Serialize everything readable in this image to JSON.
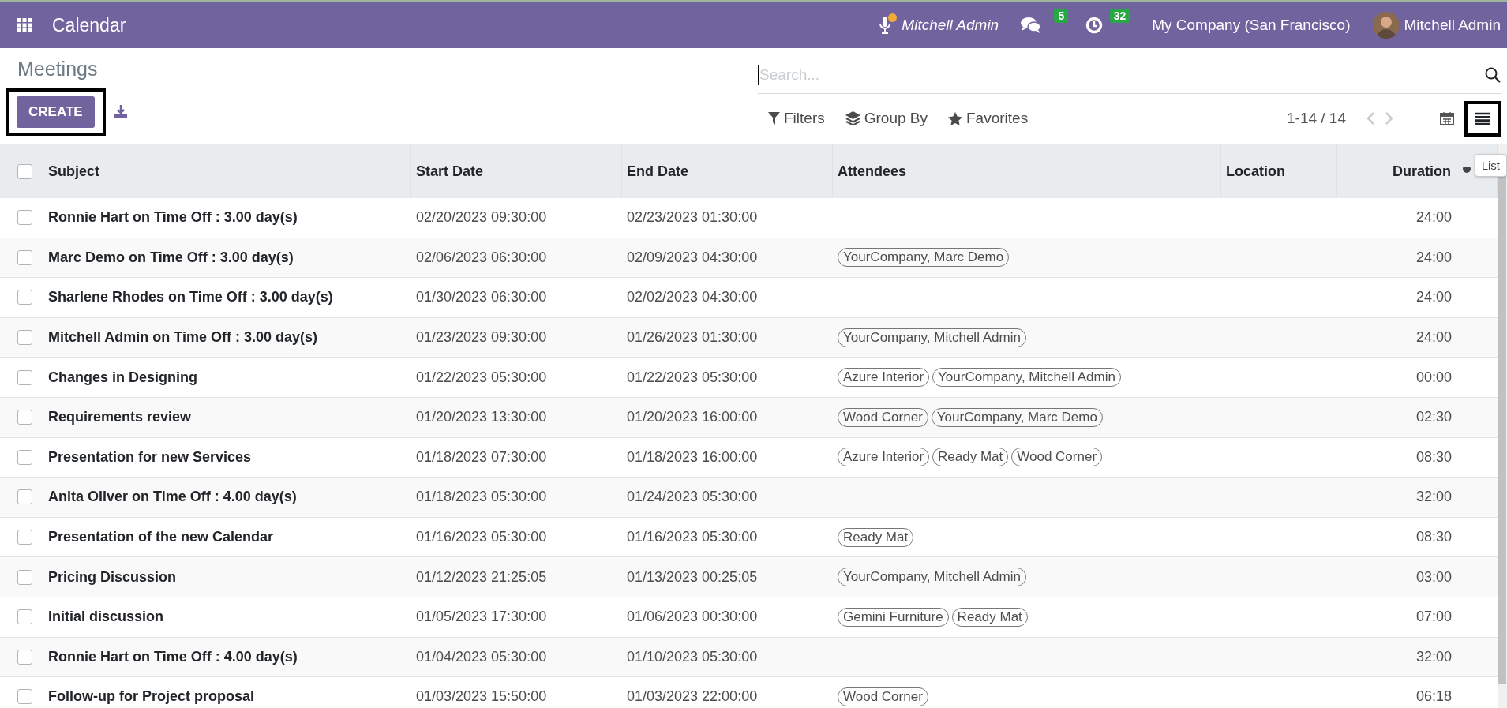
{
  "navbar": {
    "app_title": "Calendar",
    "status_user": "Mitchell Admin",
    "messages_count": "5",
    "activities_count": "32",
    "company": "My Company (San Francisco)",
    "user_name": "Mitchell Admin"
  },
  "breadcrumb": "Meetings",
  "create_button": {
    "label": "CREATE",
    "highlighted": true
  },
  "search": {
    "placeholder": "Search..."
  },
  "filters": [
    {
      "kind": "filter",
      "label": "Filters"
    },
    {
      "kind": "group",
      "label": "Group By"
    },
    {
      "kind": "favorite",
      "label": "Favorites"
    }
  ],
  "pager": "1-14 / 14",
  "views": [
    {
      "kind": "calendar",
      "selected": false,
      "highlighted": false
    },
    {
      "kind": "list",
      "selected": true,
      "highlighted": true
    }
  ],
  "tooltip": "List",
  "table": {
    "select_all_checked": false,
    "columns": [
      "Subject",
      "Start Date",
      "End Date",
      "Attendees",
      "Location",
      "Duration"
    ],
    "rows": [
      {
        "checked": false,
        "subject": "Ronnie Hart on Time Off : 3.00 day(s)",
        "start": "02/20/2023 09:30:00",
        "end": "02/23/2023 01:30:00",
        "attendees": [],
        "duration": "24:00"
      },
      {
        "checked": false,
        "subject": "Marc Demo on Time Off : 3.00 day(s)",
        "start": "02/06/2023 06:30:00",
        "end": "02/09/2023 04:30:00",
        "attendees": [
          "YourCompany, Marc Demo"
        ],
        "duration": "24:00"
      },
      {
        "checked": false,
        "subject": "Sharlene Rhodes on Time Off : 3.00 day(s)",
        "start": "01/30/2023 06:30:00",
        "end": "02/02/2023 04:30:00",
        "attendees": [],
        "duration": "24:00"
      },
      {
        "checked": false,
        "subject": "Mitchell Admin on Time Off : 3.00 day(s)",
        "start": "01/23/2023 09:30:00",
        "end": "01/26/2023 01:30:00",
        "attendees": [
          "YourCompany, Mitchell Admin"
        ],
        "duration": "24:00"
      },
      {
        "checked": false,
        "subject": "Changes in Designing",
        "start": "01/22/2023 05:30:00",
        "end": "01/22/2023 05:30:00",
        "attendees": [
          "Azure Interior",
          "YourCompany, Mitchell Admin"
        ],
        "duration": "00:00"
      },
      {
        "checked": false,
        "subject": "Requirements review",
        "start": "01/20/2023 13:30:00",
        "end": "01/20/2023 16:00:00",
        "attendees": [
          "Wood Corner",
          "YourCompany, Marc Demo"
        ],
        "duration": "02:30"
      },
      {
        "checked": false,
        "subject": "Presentation for new Services",
        "start": "01/18/2023 07:30:00",
        "end": "01/18/2023 16:00:00",
        "attendees": [
          "Azure Interior",
          "Ready Mat",
          "Wood Corner"
        ],
        "duration": "08:30"
      },
      {
        "checked": false,
        "subject": "Anita Oliver on Time Off : 4.00 day(s)",
        "start": "01/18/2023 05:30:00",
        "end": "01/24/2023 05:30:00",
        "attendees": [],
        "duration": "32:00"
      },
      {
        "checked": false,
        "subject": "Presentation of the new Calendar",
        "start": "01/16/2023 05:30:00",
        "end": "01/16/2023 05:30:00",
        "attendees": [
          "Ready Mat"
        ],
        "duration": "08:30"
      },
      {
        "checked": false,
        "subject": "Pricing Discussion",
        "start": "01/12/2023 21:25:05",
        "end": "01/13/2023 00:25:05",
        "attendees": [
          "YourCompany, Mitchell Admin"
        ],
        "duration": "03:00"
      },
      {
        "checked": false,
        "subject": "Initial discussion",
        "start": "01/05/2023 17:30:00",
        "end": "01/06/2023 00:30:00",
        "attendees": [
          "Gemini Furniture",
          "Ready Mat"
        ],
        "duration": "07:00"
      },
      {
        "checked": false,
        "subject": "Ronnie Hart on Time Off : 4.00 day(s)",
        "start": "01/04/2023 05:30:00",
        "end": "01/10/2023 05:30:00",
        "attendees": [],
        "duration": "32:00"
      },
      {
        "checked": false,
        "subject": "Follow-up for Project proposal",
        "start": "01/03/2023 15:50:00",
        "end": "01/03/2023 22:00:00",
        "attendees": [
          "Wood Corner"
        ],
        "duration": "06:18"
      }
    ]
  }
}
